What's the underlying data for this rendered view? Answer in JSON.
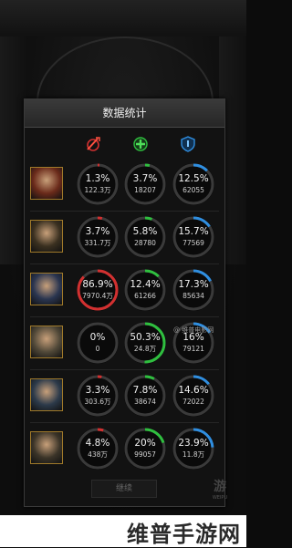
{
  "panel": {
    "title": "数据统计",
    "columns": [
      {
        "icon": "damage-dealt-icon",
        "color": "#d23030"
      },
      {
        "icon": "healing-icon",
        "color": "#2fbf3f"
      },
      {
        "icon": "damage-taken-icon",
        "color": "#2f8ee0"
      }
    ],
    "rows": [
      {
        "stats": [
          {
            "pct": "1.3%",
            "value": "122.3万",
            "fraction": 0.013,
            "color": "#d23030"
          },
          {
            "pct": "3.7%",
            "value": "18207",
            "fraction": 0.037,
            "color": "#2fbf3f"
          },
          {
            "pct": "12.5%",
            "value": "62055",
            "fraction": 0.125,
            "color": "#2f8ee0"
          }
        ]
      },
      {
        "stats": [
          {
            "pct": "3.7%",
            "value": "331.7万",
            "fraction": 0.037,
            "color": "#d23030"
          },
          {
            "pct": "5.8%",
            "value": "28780",
            "fraction": 0.058,
            "color": "#2fbf3f"
          },
          {
            "pct": "15.7%",
            "value": "77569",
            "fraction": 0.157,
            "color": "#2f8ee0"
          }
        ]
      },
      {
        "stats": [
          {
            "pct": "86.9%",
            "value": "7970.4万",
            "fraction": 0.869,
            "color": "#d23030"
          },
          {
            "pct": "12.4%",
            "value": "61266",
            "fraction": 0.124,
            "color": "#2fbf3f"
          },
          {
            "pct": "17.3%",
            "value": "85634",
            "fraction": 0.173,
            "color": "#2f8ee0"
          }
        ]
      },
      {
        "stats": [
          {
            "pct": "0%",
            "value": "0",
            "fraction": 0.0,
            "color": "#d23030"
          },
          {
            "pct": "50.3%",
            "value": "24.8万",
            "fraction": 0.503,
            "color": "#2fbf3f"
          },
          {
            "pct": "16%",
            "value": "79121",
            "fraction": 0.16,
            "color": "#2f8ee0"
          }
        ]
      },
      {
        "stats": [
          {
            "pct": "3.3%",
            "value": "303.6万",
            "fraction": 0.033,
            "color": "#d23030"
          },
          {
            "pct": "7.8%",
            "value": "38674",
            "fraction": 0.078,
            "color": "#2fbf3f"
          },
          {
            "pct": "14.6%",
            "value": "72022",
            "fraction": 0.146,
            "color": "#2f8ee0"
          }
        ]
      },
      {
        "stats": [
          {
            "pct": "4.8%",
            "value": "438万",
            "fraction": 0.048,
            "color": "#d23030"
          },
          {
            "pct": "20%",
            "value": "99057",
            "fraction": 0.2,
            "color": "#2fbf3f"
          },
          {
            "pct": "23.9%",
            "value": "11.8万",
            "fraction": 0.239,
            "color": "#2f8ee0"
          }
        ]
      }
    ],
    "avatar_colors": [
      "#6a2a1a",
      "#3a3020",
      "#2a3550",
      "#504838",
      "#2c3a4a",
      "#3b3428"
    ]
  },
  "bottom": {
    "button_label": "继续",
    "weibo_tag": "@ 维普电影网"
  },
  "footer": {
    "watermark": "维普手游网"
  }
}
